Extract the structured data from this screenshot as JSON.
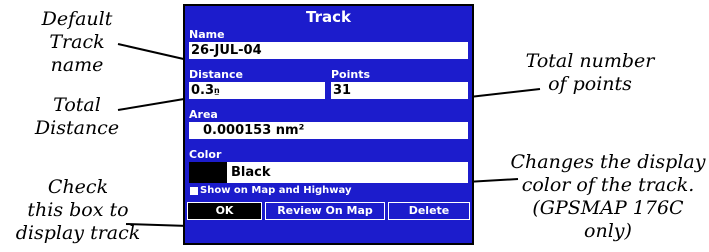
{
  "callouts": {
    "track_name": "Default\nTrack name",
    "distance": "Total\nDistance",
    "checkbox": "Check\nthis box to\ndisplay track",
    "points": "Total number\nof points",
    "color": "Changes the display\ncolor of the track.\n(GPSMAP 176C only)"
  },
  "track": {
    "title": "Track",
    "name_label": "Name",
    "name_value": "26-JUL-04",
    "distance_label": "Distance",
    "distance_value": "0.3",
    "distance_unit": "n̲",
    "points_label": "Points",
    "points_value": "31",
    "area_label": "Area",
    "area_value": "0.000153 nm²",
    "color_label": "Color",
    "color_value": "Black",
    "color_hex": "#000000",
    "show_label": "Show on Map and Highway",
    "show_checked": false,
    "buttons": {
      "ok": "OK",
      "review": "Review On Map",
      "delete": "Delete"
    }
  },
  "colors": {
    "screen_bg": "#1c1ccc",
    "selected_button_bg": "#000000"
  }
}
